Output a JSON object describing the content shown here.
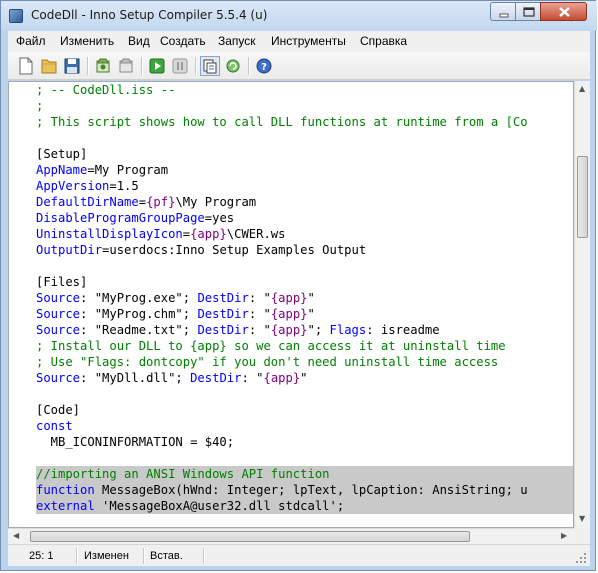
{
  "window": {
    "title": "CodeDll - Inno Setup Compiler 5.5.4 (u)"
  },
  "menu": [
    "Файл",
    "Изменить",
    "Вид",
    "Создать",
    "Запуск",
    "Инструменты",
    "Справка"
  ],
  "toolbar": {
    "buttons": [
      "new-file-icon",
      "open-folder-icon",
      "save-icon",
      "compile-icon",
      "stop-compile-icon",
      "run-icon",
      "pause-icon",
      "target-icon",
      "uninstall-icon",
      "help-icon"
    ]
  },
  "editor": {
    "lines": [
      [
        {
          "t": "; -- CodeDll.iss --",
          "c": "comment"
        }
      ],
      [
        {
          "t": ";",
          "c": "comment"
        }
      ],
      [
        {
          "t": "; This script shows how to call DLL functions at runtime from a [Co",
          "c": "comment"
        }
      ],
      [],
      [
        {
          "t": "[Setup]",
          "c": "section"
        }
      ],
      [
        {
          "t": "AppName",
          "c": "key"
        },
        {
          "t": "=My Program",
          "c": "text"
        }
      ],
      [
        {
          "t": "AppVersion",
          "c": "key"
        },
        {
          "t": "=1.5",
          "c": "text"
        }
      ],
      [
        {
          "t": "DefaultDirName",
          "c": "key"
        },
        {
          "t": "=",
          "c": "text"
        },
        {
          "t": "{pf}",
          "c": "const"
        },
        {
          "t": "\\My Program",
          "c": "text"
        }
      ],
      [
        {
          "t": "DisableProgramGroupPage",
          "c": "key"
        },
        {
          "t": "=yes",
          "c": "text"
        }
      ],
      [
        {
          "t": "UninstallDisplayIcon",
          "c": "key"
        },
        {
          "t": "=",
          "c": "text"
        },
        {
          "t": "{app}",
          "c": "const"
        },
        {
          "t": "\\CWER.ws",
          "c": "text"
        }
      ],
      [
        {
          "t": "OutputDir",
          "c": "key"
        },
        {
          "t": "=userdocs:Inno Setup Examples Output",
          "c": "text"
        }
      ],
      [],
      [
        {
          "t": "[Files]",
          "c": "section"
        }
      ],
      [
        {
          "t": "Source",
          "c": "key"
        },
        {
          "t": ": \"MyProg.exe\"; ",
          "c": "text"
        },
        {
          "t": "DestDir",
          "c": "key"
        },
        {
          "t": ": \"",
          "c": "text"
        },
        {
          "t": "{app}",
          "c": "const"
        },
        {
          "t": "\"",
          "c": "text"
        }
      ],
      [
        {
          "t": "Source",
          "c": "key"
        },
        {
          "t": ": \"MyProg.chm\"; ",
          "c": "text"
        },
        {
          "t": "DestDir",
          "c": "key"
        },
        {
          "t": ": \"",
          "c": "text"
        },
        {
          "t": "{app}",
          "c": "const"
        },
        {
          "t": "\"",
          "c": "text"
        }
      ],
      [
        {
          "t": "Source",
          "c": "key"
        },
        {
          "t": ": \"Readme.txt\"; ",
          "c": "text"
        },
        {
          "t": "DestDir",
          "c": "key"
        },
        {
          "t": ": \"",
          "c": "text"
        },
        {
          "t": "{app}",
          "c": "const"
        },
        {
          "t": "\"; ",
          "c": "text"
        },
        {
          "t": "Flags",
          "c": "key"
        },
        {
          "t": ": isreadme",
          "c": "text"
        }
      ],
      [
        {
          "t": "; Install our DLL to {app} so we can access it at uninstall time",
          "c": "comment"
        }
      ],
      [
        {
          "t": "; Use \"Flags: dontcopy\" if you don't need uninstall time access",
          "c": "comment"
        }
      ],
      [
        {
          "t": "Source",
          "c": "key"
        },
        {
          "t": ": \"MyDll.dll\"; ",
          "c": "text"
        },
        {
          "t": "DestDir",
          "c": "key"
        },
        {
          "t": ": \"",
          "c": "text"
        },
        {
          "t": "{app}",
          "c": "const"
        },
        {
          "t": "\"",
          "c": "text"
        }
      ],
      [],
      [
        {
          "t": "[Code]",
          "c": "section"
        }
      ],
      [
        {
          "t": "const",
          "c": "key"
        }
      ],
      [
        {
          "t": "  MB_ICONINFORMATION = $40;",
          "c": "text"
        }
      ],
      [],
      [
        {
          "t": "//importing an ANSI Windows API function",
          "c": "comment"
        }
      ],
      [
        {
          "t": "function",
          "c": "key"
        },
        {
          "t": " MessageBox(hWnd: Integer; lpText, lpCaption: AnsiString; u",
          "c": "text"
        }
      ],
      [
        {
          "t": "external",
          "c": "key"
        },
        {
          "t": " 'MessageBoxA@user32.dll stdcall';",
          "c": "text"
        }
      ]
    ],
    "selected_lines": [
      24,
      25,
      26
    ]
  },
  "status": {
    "position": "25:  1",
    "modified": "Изменен",
    "insert_mode": "Встав."
  }
}
